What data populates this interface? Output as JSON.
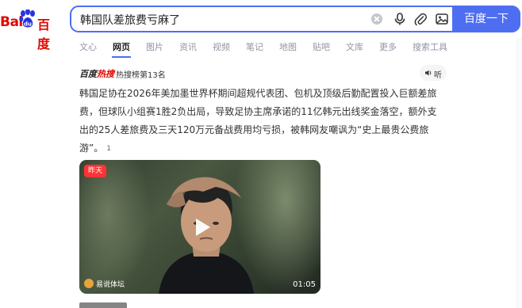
{
  "brand": {
    "bai": "Bai",
    "du": "百度"
  },
  "search": {
    "query": "韩国队差旅费亏麻了",
    "button_label": "百度一下"
  },
  "tabs": [
    "文心",
    "网页",
    "图片",
    "资讯",
    "视频",
    "笔记",
    "地图",
    "贴吧",
    "文库",
    "更多",
    "搜索工具"
  ],
  "result": {
    "hot_brand": "百度",
    "hot_brand_red": "热搜",
    "rank_text": "热搜榜第13名",
    "listen_label": "听",
    "snippet": "韩国足协在2026年美加墨世界杯期间超规代表团、包机及顶级后勤配置投入巨额差旅费，但球队小组赛1胜2负出局，导致足协主席承诺的11亿韩元出线奖金落空，额外支出的25人差旅费及三天120万元备战费用均亏损，被韩网友嘲讽为“史上最贵公费旅游”。",
    "ref": "1",
    "video": {
      "badge": "昨天",
      "source": "易说体坛",
      "duration": "01:05"
    }
  },
  "colors": {
    "accent": "#4e6ef2",
    "brand_red": "#e10601"
  }
}
